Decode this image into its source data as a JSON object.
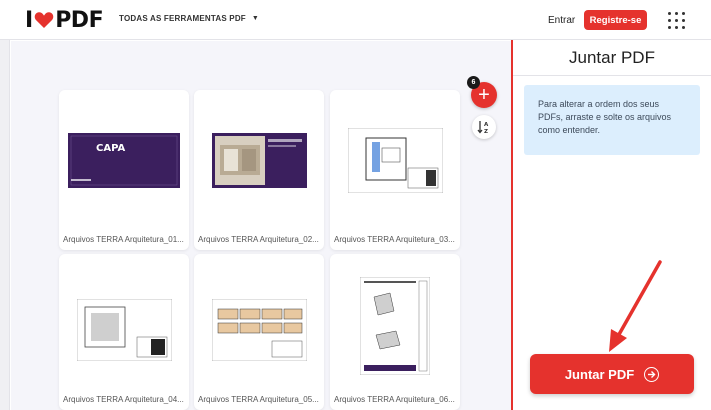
{
  "header": {
    "logo_i": "I",
    "logo_pdf": "PDF",
    "tools_label": "TODAS AS FERRAMENTAS PDF",
    "login_label": "Entrar",
    "signup_label": "Registre-se"
  },
  "workspace": {
    "file_count": "6",
    "files": [
      {
        "name": "Arquivos TERRA Arquitetura_01...",
        "thumb_text": "CAPA"
      },
      {
        "name": "Arquivos TERRA Arquitetura_02..."
      },
      {
        "name": "Arquivos TERRA Arquitetura_03..."
      },
      {
        "name": "Arquivos TERRA Arquitetura_04..."
      },
      {
        "name": "Arquivos TERRA Arquitetura_05..."
      },
      {
        "name": "Arquivos TERRA Arquitetura_06..."
      }
    ]
  },
  "panel": {
    "title": "Juntar PDF",
    "info_text": "Para alterar a ordem dos seus PDFs, arraste e solte os arquivos como entender.",
    "merge_label": "Juntar PDF"
  },
  "colors": {
    "brand": "#e5322d",
    "info_bg": "#dceefd",
    "workspace_bg": "#f5f5fa",
    "cover_purple": "#3b1f5e"
  },
  "icons": [
    "heart-icon",
    "chevron-down-icon",
    "apps-grid-icon",
    "plus-icon",
    "sort-az-icon",
    "arrow-right-circle-icon"
  ]
}
